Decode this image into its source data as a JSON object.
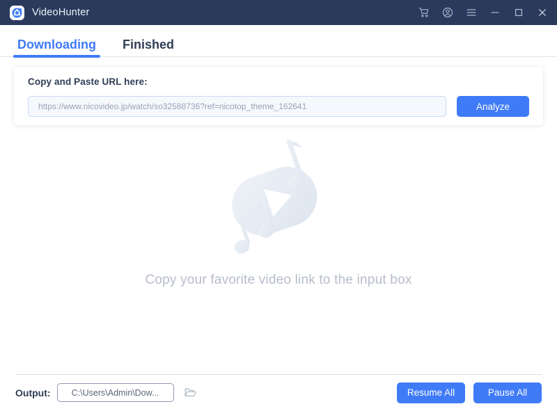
{
  "window": {
    "app_name": "VideoHunter",
    "logo_icon": "videohunter-logo-icon",
    "titlebar_bg": "#2b3a5c",
    "controls": [
      {
        "name": "cart-icon",
        "label": "Cart"
      },
      {
        "name": "account-icon",
        "label": "Account"
      },
      {
        "name": "menu-icon",
        "label": "Menu"
      },
      {
        "name": "minimize-icon",
        "label": "Minimize"
      },
      {
        "name": "maximize-icon",
        "label": "Maximize"
      },
      {
        "name": "close-icon",
        "label": "Close"
      }
    ]
  },
  "tabs": [
    {
      "label": "Downloading",
      "active": true
    },
    {
      "label": "Finished",
      "active": false
    }
  ],
  "url_card": {
    "label": "Copy and Paste URL here:",
    "input_value": "",
    "input_placeholder": "https://www.nicovideo.jp/watch/so32588736?ref=nicotop_theme_162641",
    "analyze_label": "Analyze"
  },
  "empty_state": {
    "illustration": "play-button-with-music-notes-illustration",
    "message": "Copy your favorite video link to the input box"
  },
  "footer": {
    "output_label": "Output:",
    "output_path": "C:\\Users\\Admin\\Dow...",
    "folder_icon": "open-folder-icon",
    "resume_all_label": "Resume All",
    "pause_all_label": "Pause All"
  },
  "colors": {
    "accent": "#3f7bf7",
    "titlebar": "#2b3a5c",
    "heading_text": "#2f3d56",
    "muted_text": "#b6bdca",
    "illustration": "#e4eaf2"
  }
}
